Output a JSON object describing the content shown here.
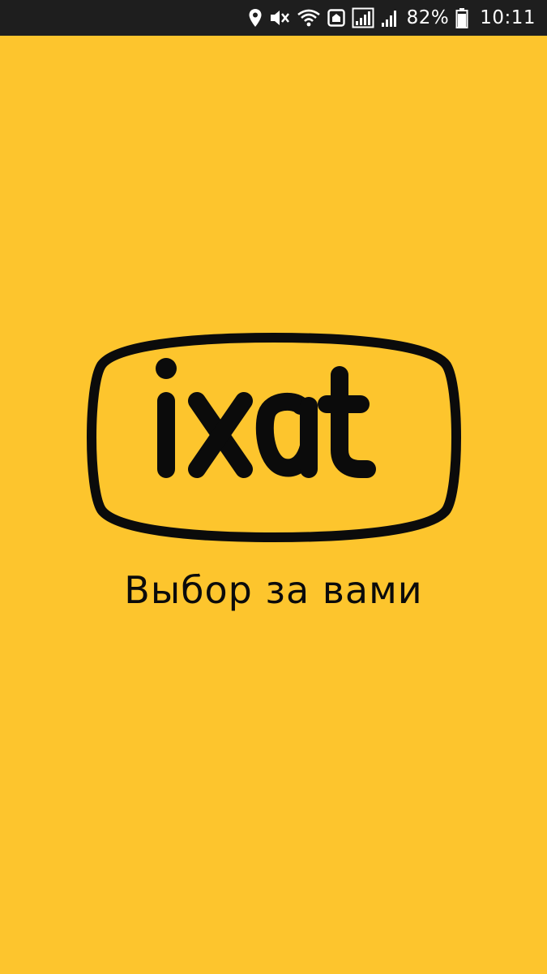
{
  "status_bar": {
    "battery_percent": "82%",
    "time": "10:11",
    "icons": [
      "location-icon",
      "mute-icon",
      "wifi-icon",
      "sim-icon",
      "signal-icon",
      "signal-icon-2",
      "battery-icon"
    ]
  },
  "splash": {
    "brand_logo_text": "ixat",
    "slogan": "Выбор за вами"
  },
  "colors": {
    "background": "#FDC52D",
    "status_bar": "#1E1E1E",
    "logo": "#0B0B0B"
  }
}
